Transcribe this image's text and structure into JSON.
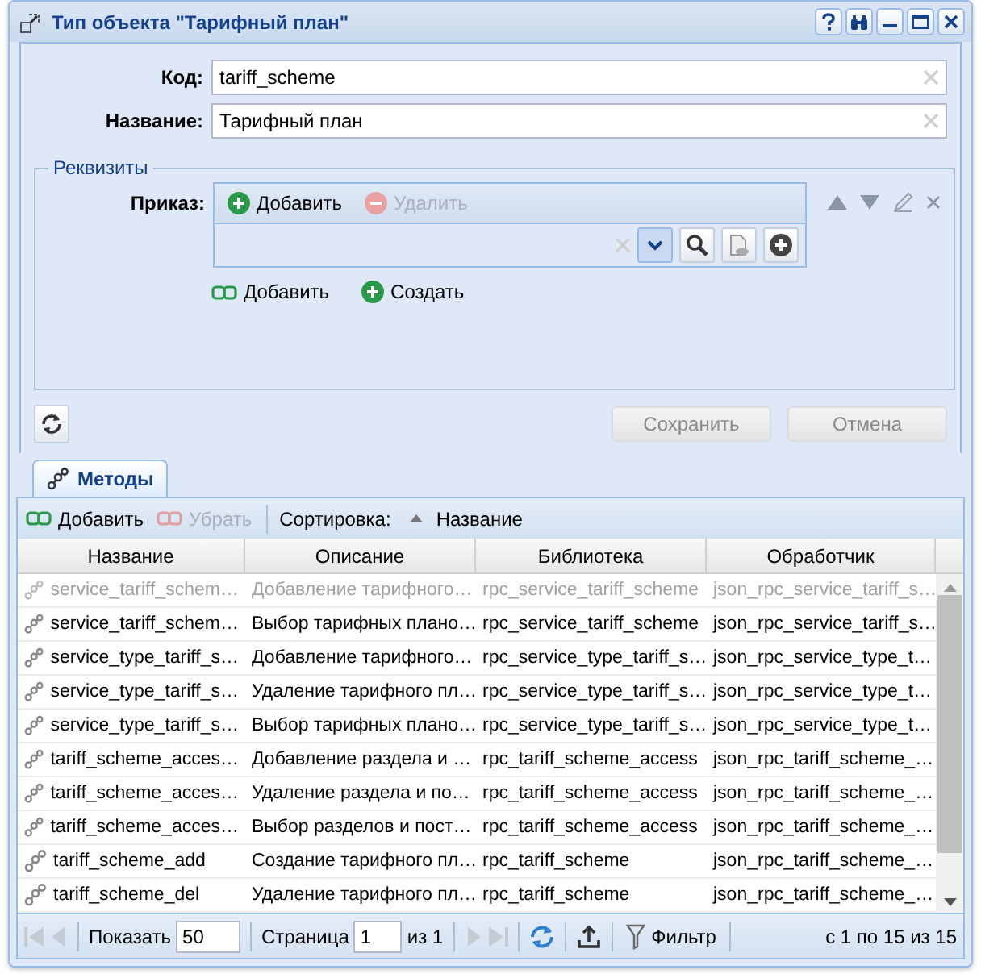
{
  "window": {
    "title": "Тип объекта \"Тарифный план\""
  },
  "fields": [
    {
      "label": "Код:",
      "value": "tariff_scheme"
    },
    {
      "label": "Название:",
      "value": "Тарифный план"
    }
  ],
  "requisites": {
    "legend": "Реквизиты",
    "field_label": "Приказ:",
    "toolbar": [
      {
        "label": "Добавить",
        "kind": "add",
        "disabled": false
      },
      {
        "label": "Удалить",
        "kind": "remove",
        "disabled": true
      }
    ],
    "links": [
      {
        "label": "Добавить",
        "kind": "link"
      },
      {
        "label": "Создать",
        "kind": "add"
      }
    ]
  },
  "actions": [
    {
      "label": "Сохранить",
      "disabled": true
    },
    {
      "label": "Отмена",
      "disabled": true
    }
  ],
  "tabs": [
    {
      "label": "Методы",
      "selected": true
    }
  ],
  "grid": {
    "toolbar": [
      {
        "label": "Добавить",
        "kind": "link",
        "disabled": false
      },
      {
        "label": "Убрать",
        "kind": "unlink",
        "disabled": true
      }
    ],
    "sort_label": "Сортировка:",
    "sort_button": "Название",
    "columns": [
      "Название",
      "Описание",
      "Библиотека",
      "Обработчик"
    ],
    "rows": [
      {
        "disabled": true,
        "cells": [
          "service_tariff_schem…",
          "Добавление тарифного…",
          "rpc_service_tariff_scheme",
          "json_rpc_service_tariff_s…"
        ]
      },
      {
        "disabled": false,
        "cells": [
          "service_tariff_schem…",
          "Выбор тарифных плано…",
          "rpc_service_tariff_scheme",
          "json_rpc_service_tariff_s…"
        ]
      },
      {
        "disabled": false,
        "cells": [
          "service_type_tariff_s…",
          "Добавление тарифного…",
          "rpc_service_type_tariff_s…",
          "json_rpc_service_type_t…"
        ]
      },
      {
        "disabled": false,
        "cells": [
          "service_type_tariff_s…",
          "Удаление тарифного пл…",
          "rpc_service_type_tariff_s…",
          "json_rpc_service_type_t…"
        ]
      },
      {
        "disabled": false,
        "cells": [
          "service_type_tariff_s…",
          "Выбор тарифных плано…",
          "rpc_service_type_tariff_s…",
          "json_rpc_service_type_t…"
        ]
      },
      {
        "disabled": false,
        "cells": [
          "tariff_scheme_acces…",
          "Добавление раздела и …",
          "rpc_tariff_scheme_access",
          "json_rpc_tariff_scheme_…"
        ]
      },
      {
        "disabled": false,
        "cells": [
          "tariff_scheme_acces…",
          "Удаление раздела и по…",
          "rpc_tariff_scheme_access",
          "json_rpc_tariff_scheme_…"
        ]
      },
      {
        "disabled": false,
        "cells": [
          "tariff_scheme_acces…",
          "Выбор разделов и пост…",
          "rpc_tariff_scheme_access",
          "json_rpc_tariff_scheme_…"
        ]
      },
      {
        "disabled": false,
        "cells": [
          "tariff_scheme_add",
          "Создание тарифного пл…",
          "rpc_tariff_scheme",
          "json_rpc_tariff_scheme_…"
        ]
      },
      {
        "disabled": false,
        "cells": [
          "tariff_scheme_del",
          "Удаление тарифного пл…",
          "rpc_tariff_scheme",
          "json_rpc_tariff_scheme_…"
        ]
      }
    ]
  },
  "pager": {
    "show_label": "Показать",
    "page_size": "50",
    "page_label": "Страница",
    "page": "1",
    "of": "из 1",
    "filter": "Фильтр",
    "summary": "с 1 по 15 из 15"
  }
}
